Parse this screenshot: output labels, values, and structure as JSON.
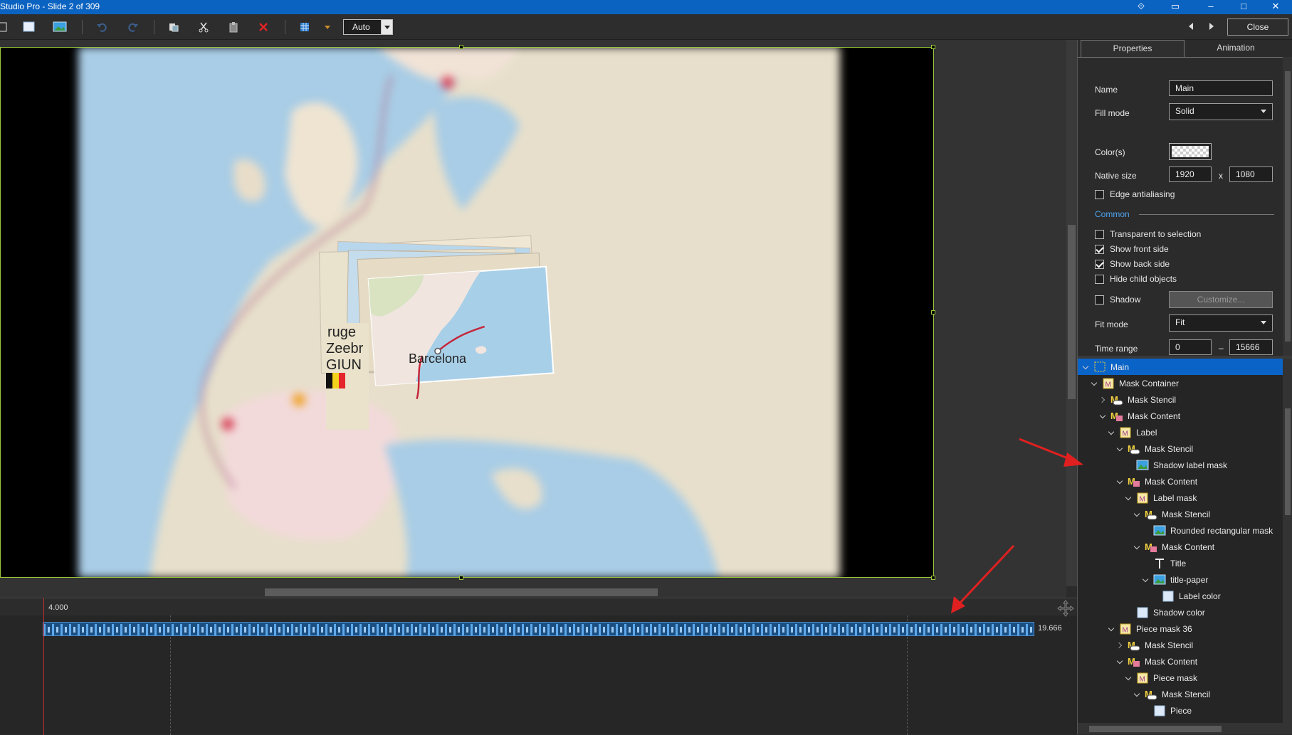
{
  "window": {
    "title": "Studio Pro - Slide 2 of 309"
  },
  "toolbar": {
    "zoom_value": "Auto",
    "close_label": "Close"
  },
  "canvas": {
    "map_city_label": "Barcelona",
    "map_partial_text": [
      "ruge",
      "Zeebr",
      "GIUN"
    ]
  },
  "timeline": {
    "start_time": "4.000",
    "end_time": "19.666"
  },
  "properties": {
    "tabs": [
      "Properties",
      "Animation"
    ],
    "name_label": "Name",
    "name_value": "Main",
    "fill_mode_label": "Fill mode",
    "fill_mode_value": "Solid",
    "colors_label": "Color(s)",
    "native_size_label": "Native size",
    "native_width": "1920",
    "native_x": "x",
    "native_height": "1080",
    "edge_aa_label": "Edge antialiasing",
    "edge_aa_checked": false,
    "common_section": "Common",
    "transparent_label": "Transparent to selection",
    "transparent_checked": false,
    "show_front_label": "Show front side",
    "show_front_checked": true,
    "show_back_label": "Show back side",
    "show_back_checked": true,
    "hide_child_label": "Hide child objects",
    "hide_child_checked": false,
    "shadow_label": "Shadow",
    "shadow_checked": false,
    "customize_label": "Customize...",
    "fit_mode_label": "Fit mode",
    "fit_mode_value": "Fit",
    "time_range_label": "Time range",
    "time_start": "0",
    "time_dash": "–",
    "time_end": "15666"
  },
  "tree": [
    {
      "label": "Main",
      "level": 0,
      "chevron": "down",
      "icon": "frame",
      "selected": true
    },
    {
      "label": "Mask Container",
      "level": 1,
      "chevron": "down",
      "icon": "mask-container"
    },
    {
      "label": "Mask Stencil",
      "level": 2,
      "chevron": "right",
      "icon": "stencil"
    },
    {
      "label": "Mask Content",
      "level": 2,
      "chevron": "down",
      "icon": "content"
    },
    {
      "label": "Label",
      "level": 3,
      "chevron": "down",
      "icon": "mask-container"
    },
    {
      "label": "Mask Stencil",
      "level": 4,
      "chevron": "down",
      "icon": "stencil"
    },
    {
      "label": "Shadow label mask",
      "level": 5,
      "chevron": "none",
      "icon": "image"
    },
    {
      "label": "Mask Content",
      "level": 4,
      "chevron": "down",
      "icon": "content"
    },
    {
      "label": "Label mask",
      "level": 5,
      "chevron": "down",
      "icon": "mask-container"
    },
    {
      "label": "Mask Stencil",
      "level": 6,
      "chevron": "down",
      "icon": "stencil"
    },
    {
      "label": "Rounded rectangular mask",
      "level": 7,
      "chevron": "none",
      "icon": "image"
    },
    {
      "label": "Mask Content",
      "level": 6,
      "chevron": "down",
      "icon": "content"
    },
    {
      "label": "Title",
      "level": 7,
      "chevron": "none",
      "icon": "text"
    },
    {
      "label": "title-paper",
      "level": 7,
      "chevron": "down",
      "icon": "image"
    },
    {
      "label": "Label color",
      "level": 8,
      "chevron": "none",
      "icon": "rect"
    },
    {
      "label": "Shadow color",
      "level": 5,
      "chevron": "none",
      "icon": "rect"
    },
    {
      "label": "Piece mask 36",
      "level": 3,
      "chevron": "down",
      "icon": "mask-container"
    },
    {
      "label": "Mask Stencil",
      "level": 4,
      "chevron": "right",
      "icon": "stencil"
    },
    {
      "label": "Mask Content",
      "level": 4,
      "chevron": "down",
      "icon": "content"
    },
    {
      "label": "Piece mask",
      "level": 5,
      "chevron": "down",
      "icon": "mask-container"
    },
    {
      "label": "Mask Stencil",
      "level": 6,
      "chevron": "down",
      "icon": "stencil"
    },
    {
      "label": "Piece",
      "level": 7,
      "chevron": "none",
      "icon": "rect"
    }
  ],
  "colors": {
    "selection": "#0a64c8",
    "accent": "#4ea3ef",
    "annotation_arrow": "#e02020",
    "frame": "#9ac73c"
  }
}
